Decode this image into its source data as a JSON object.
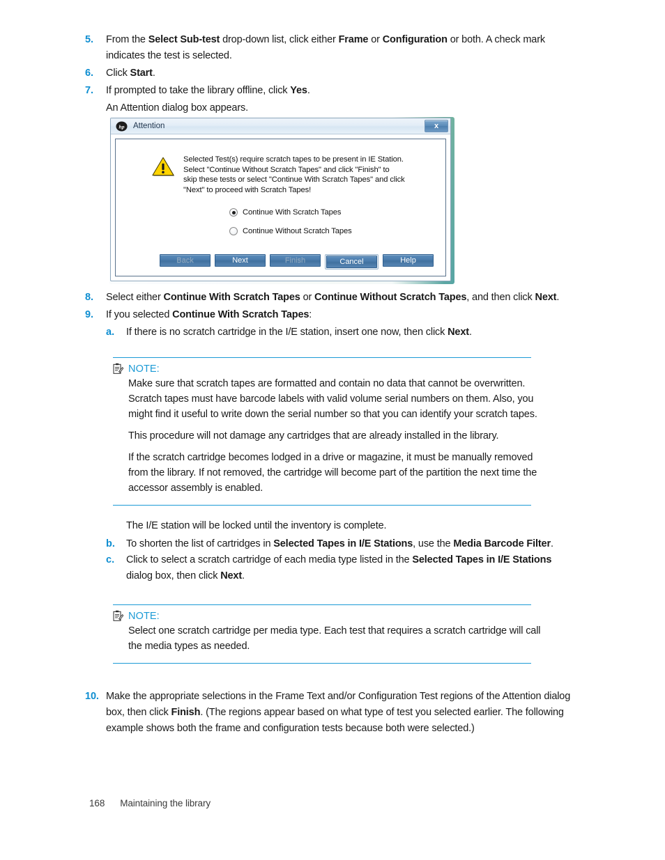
{
  "document": {
    "footer": {
      "page_number": "168",
      "section_title": "Maintaining the library"
    }
  },
  "steps": [
    {
      "number": "5.",
      "text_html": "From the <b>Select Sub-test</b> drop-down list, click either <b>Frame</b> or <b>Configuration</b> or both. A check mark indicates the test is selected.",
      "text": "From the Select Sub-test drop-down list, click either Frame or Configuration or both. A check mark indicates the test is selected."
    },
    {
      "number": "6.",
      "text_html": "Click <b>Start</b>.",
      "text": "Click Start."
    },
    {
      "number": "7.",
      "text_html": "If prompted to take the library offline, click <b>Yes</b>.",
      "text": "If prompted to take the library offline, click Yes.",
      "continuation": "An Attention dialog box appears."
    },
    {
      "number": "8.",
      "text_html": "Select either <b>Continue With Scratch Tapes</b> or <b>Continue Without Scratch Tapes</b>, and then click <b>Next</b>.",
      "text": "Select either Continue With Scratch Tapes or Continue Without Scratch Tapes, and then click Next."
    },
    {
      "number": "9.",
      "text_html": "If you selected <b>Continue With Scratch Tapes</b>:",
      "text": "If you selected Continue With Scratch Tapes:"
    },
    {
      "number": "10.",
      "text_html": "Make the appropriate selections in the Frame Text and/or Configuration Test regions of the Attention dialog box, then click <b>Finish</b>. (The regions appear based on what type of test you selected earlier. The following example shows both the frame and configuration tests because both were selected.)",
      "text": "Make the appropriate selections in the Frame Text and/or Configuration Test regions of the Attention dialog box, then click Finish. (The regions appear based on what type of test you selected earlier. The following example shows both the frame and configuration tests because both were selected.)"
    }
  ],
  "substeps": [
    {
      "letter": "a.",
      "text_html": "If there is no scratch cartridge in the I/E station, insert one now, then click <b>Next</b>.",
      "text": "If there is no scratch cartridge in the I/E station, insert one now, then click Next."
    },
    {
      "letter": "b.",
      "text_html": "To shorten the list of cartridges in <b>Selected Tapes in I/E Stations</b>, use the <b>Media Barcode Filter</b>.",
      "text": "To shorten the list of cartridges in Selected Tapes in I/E Stations, use the Media Barcode Filter."
    },
    {
      "letter": "c.",
      "text_html": "Click to select a scratch cartridge of each media type listed in the <b>Selected Tapes in I/E Stations</b> dialog box, then click <b>Next</b>.",
      "text": "Click to select a scratch cartridge of each media type listed in the Selected Tapes in I/E Stations dialog box, then click Next."
    }
  ],
  "interstitial_text": "The I/E station will be locked until the inventory is complete.",
  "notes": [
    {
      "label": "NOTE:",
      "icon": "note-clipboard-icon",
      "paragraphs": [
        "Make sure that scratch tapes are formatted and contain no data that cannot be overwritten. Scratch tapes must have barcode labels with valid volume serial numbers on them. Also, you might find it useful to write down the serial number so that you can identify your scratch tapes.",
        "This procedure will not damage any cartridges that are already installed in the library.",
        "If the scratch cartridge becomes lodged in a drive or magazine, it must be manually removed from the library. If not removed, the cartridge will become part of the partition the next time the accessor assembly is enabled."
      ]
    },
    {
      "label": "NOTE:",
      "icon": "note-clipboard-icon",
      "paragraphs": [
        "Select one scratch cartridge per media type. Each test that requires a scratch cartridge will call the media types as needed."
      ]
    }
  ],
  "dialog": {
    "title": "Attention",
    "logo": "hp-logo-icon",
    "close_label": "x",
    "warning_icon": "warning-triangle-icon",
    "message": "Selected Test(s) require scratch tapes to be present in IE Station. Select \"Continue Without Scratch Tapes\" and click \"Finish\" to skip these tests or select \"Continue With Scratch Tapes\" and click \"Next\" to proceed with Scratch Tapes!",
    "message_lines": [
      "Selected Test(s) require scratch tapes to be present in IE Station.",
      "Select \"Continue Without Scratch Tapes\" and click \"Finish\" to",
      "skip these tests or select \"Continue With Scratch Tapes\" and click",
      "\"Next\" to proceed with Scratch Tapes!"
    ],
    "radios": [
      {
        "label": "Continue With Scratch Tapes",
        "selected": true
      },
      {
        "label": "Continue Without Scratch Tapes",
        "selected": false
      }
    ],
    "buttons": [
      {
        "label": "Back",
        "disabled": true,
        "focused": false
      },
      {
        "label": "Next",
        "disabled": false,
        "focused": false
      },
      {
        "label": "Finish",
        "disabled": true,
        "focused": false
      },
      {
        "label": "Cancel",
        "disabled": false,
        "focused": true
      },
      {
        "label": "Help",
        "disabled": false,
        "focused": false
      }
    ]
  },
  "colors": {
    "accent_blue": "#0f8ed1",
    "note_blue": "#1b9ad6",
    "body_text": "#1a1a1a",
    "warning_yellow": "#ffd400",
    "button_blue": "#4a7bab"
  }
}
